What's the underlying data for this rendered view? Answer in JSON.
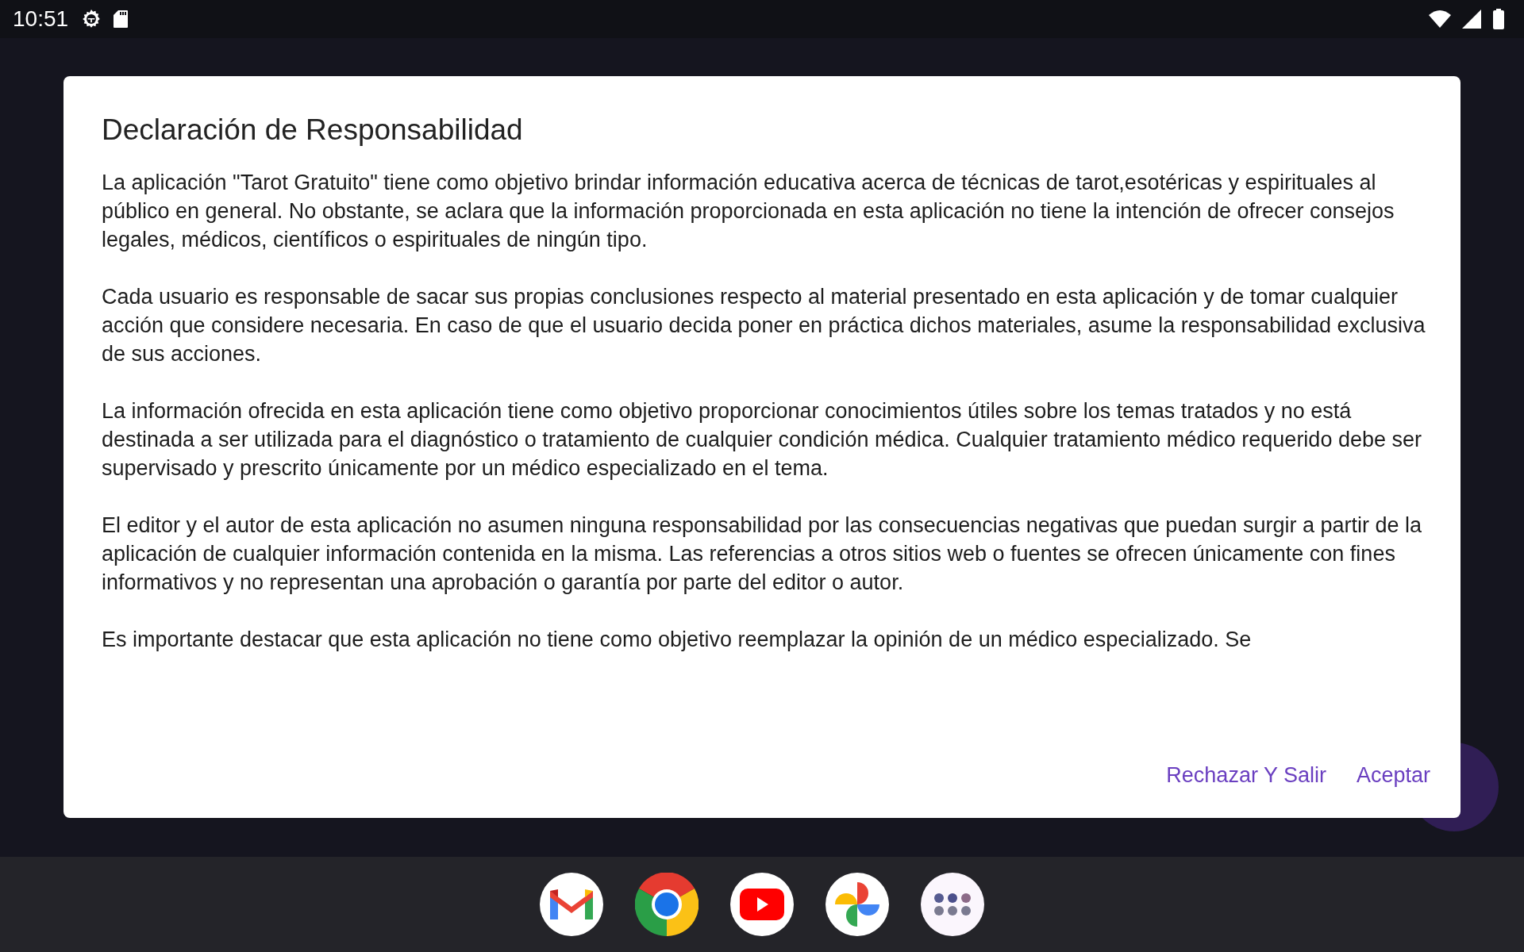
{
  "status_bar": {
    "time": "10:51"
  },
  "dialog": {
    "title": "Declaración de Responsabilidad",
    "paragraphs": [
      "La aplicación \"Tarot Gratuito\" tiene como objetivo brindar información educativa acerca de técnicas de tarot,esotéricas y espirituales al público en general. No obstante, se aclara que la información proporcionada en esta aplicación no tiene la intención de ofrecer consejos legales, médicos, científicos o espirituales de ningún tipo.",
      "Cada usuario es responsable de sacar sus propias conclusiones respecto al material presentado en esta aplicación y de tomar cualquier acción que considere necesaria. En caso de que el usuario decida poner en práctica dichos materiales, asume la responsabilidad exclusiva de sus acciones.",
      "La información ofrecida en esta aplicación tiene como objetivo proporcionar conocimientos útiles sobre los temas tratados y no está destinada a ser utilizada para el diagnóstico o tratamiento de cualquier condición médica. Cualquier tratamiento médico requerido debe ser supervisado y prescrito únicamente por un médico especializado en el tema.",
      "El editor y el autor de esta aplicación no asumen ninguna responsabilidad por las consecuencias negativas que puedan surgir a partir de la aplicación de cualquier información contenida en la misma. Las referencias a otros sitios web o fuentes se ofrecen únicamente con fines informativos y no representan una aprobación o garantía por parte del editor o autor.",
      "Es importante destacar que esta aplicación no tiene como objetivo reemplazar la opinión de un médico especializado. Se"
    ],
    "buttons": [
      "Rechazar Y Salir",
      "Aceptar"
    ]
  }
}
